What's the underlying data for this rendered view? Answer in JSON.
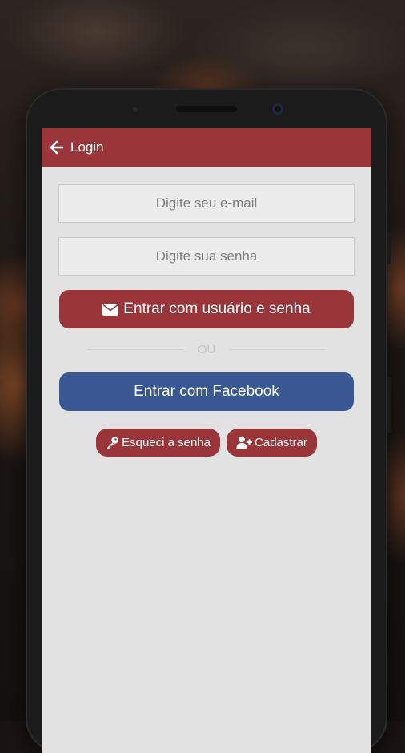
{
  "appbar": {
    "title": "Login",
    "back_icon": "arrow-left-icon"
  },
  "form": {
    "email_placeholder": "Digite seu e-mail",
    "password_placeholder": "Digite sua senha",
    "login_button_label": "Entrar com usuário e senha",
    "login_button_icon": "envelope-icon",
    "divider_label": "OU",
    "facebook_button_label": "Entrar com Facebook",
    "forgot_button_label": "Esqueci a senha",
    "forgot_button_icon": "key-icon",
    "register_button_label": "Cadastrar",
    "register_button_icon": "user-plus-icon"
  },
  "colors": {
    "primary": "#9a3539",
    "facebook": "#3a5894",
    "screen_background": "#e2e2e2"
  }
}
